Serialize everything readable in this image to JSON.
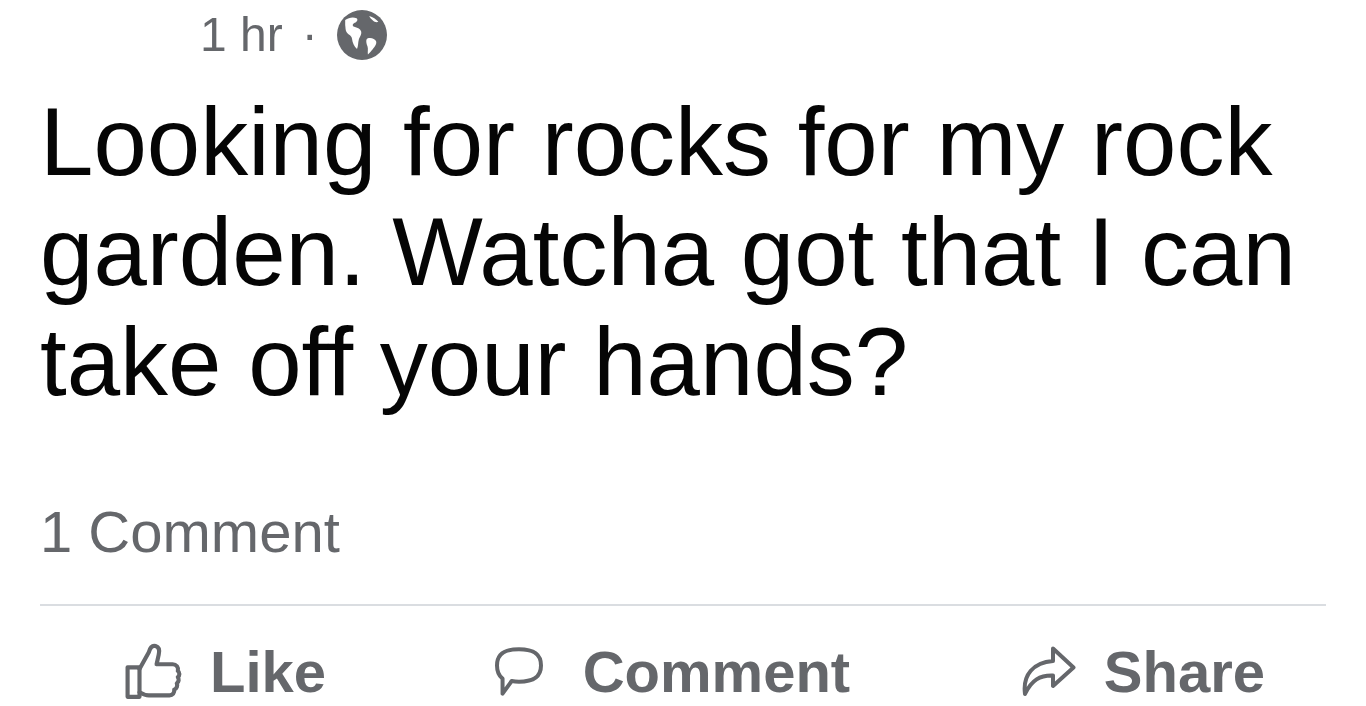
{
  "post": {
    "time": "1 hr",
    "separator": "·",
    "text": "Looking for rocks for my rock garden. Watcha got that I can take off your hands?",
    "comment_count": "1 Comment",
    "actions": [
      {
        "kind": "like",
        "label": "Like"
      },
      {
        "kind": "comment",
        "label": "Comment"
      },
      {
        "kind": "share",
        "label": "Share"
      }
    ]
  }
}
